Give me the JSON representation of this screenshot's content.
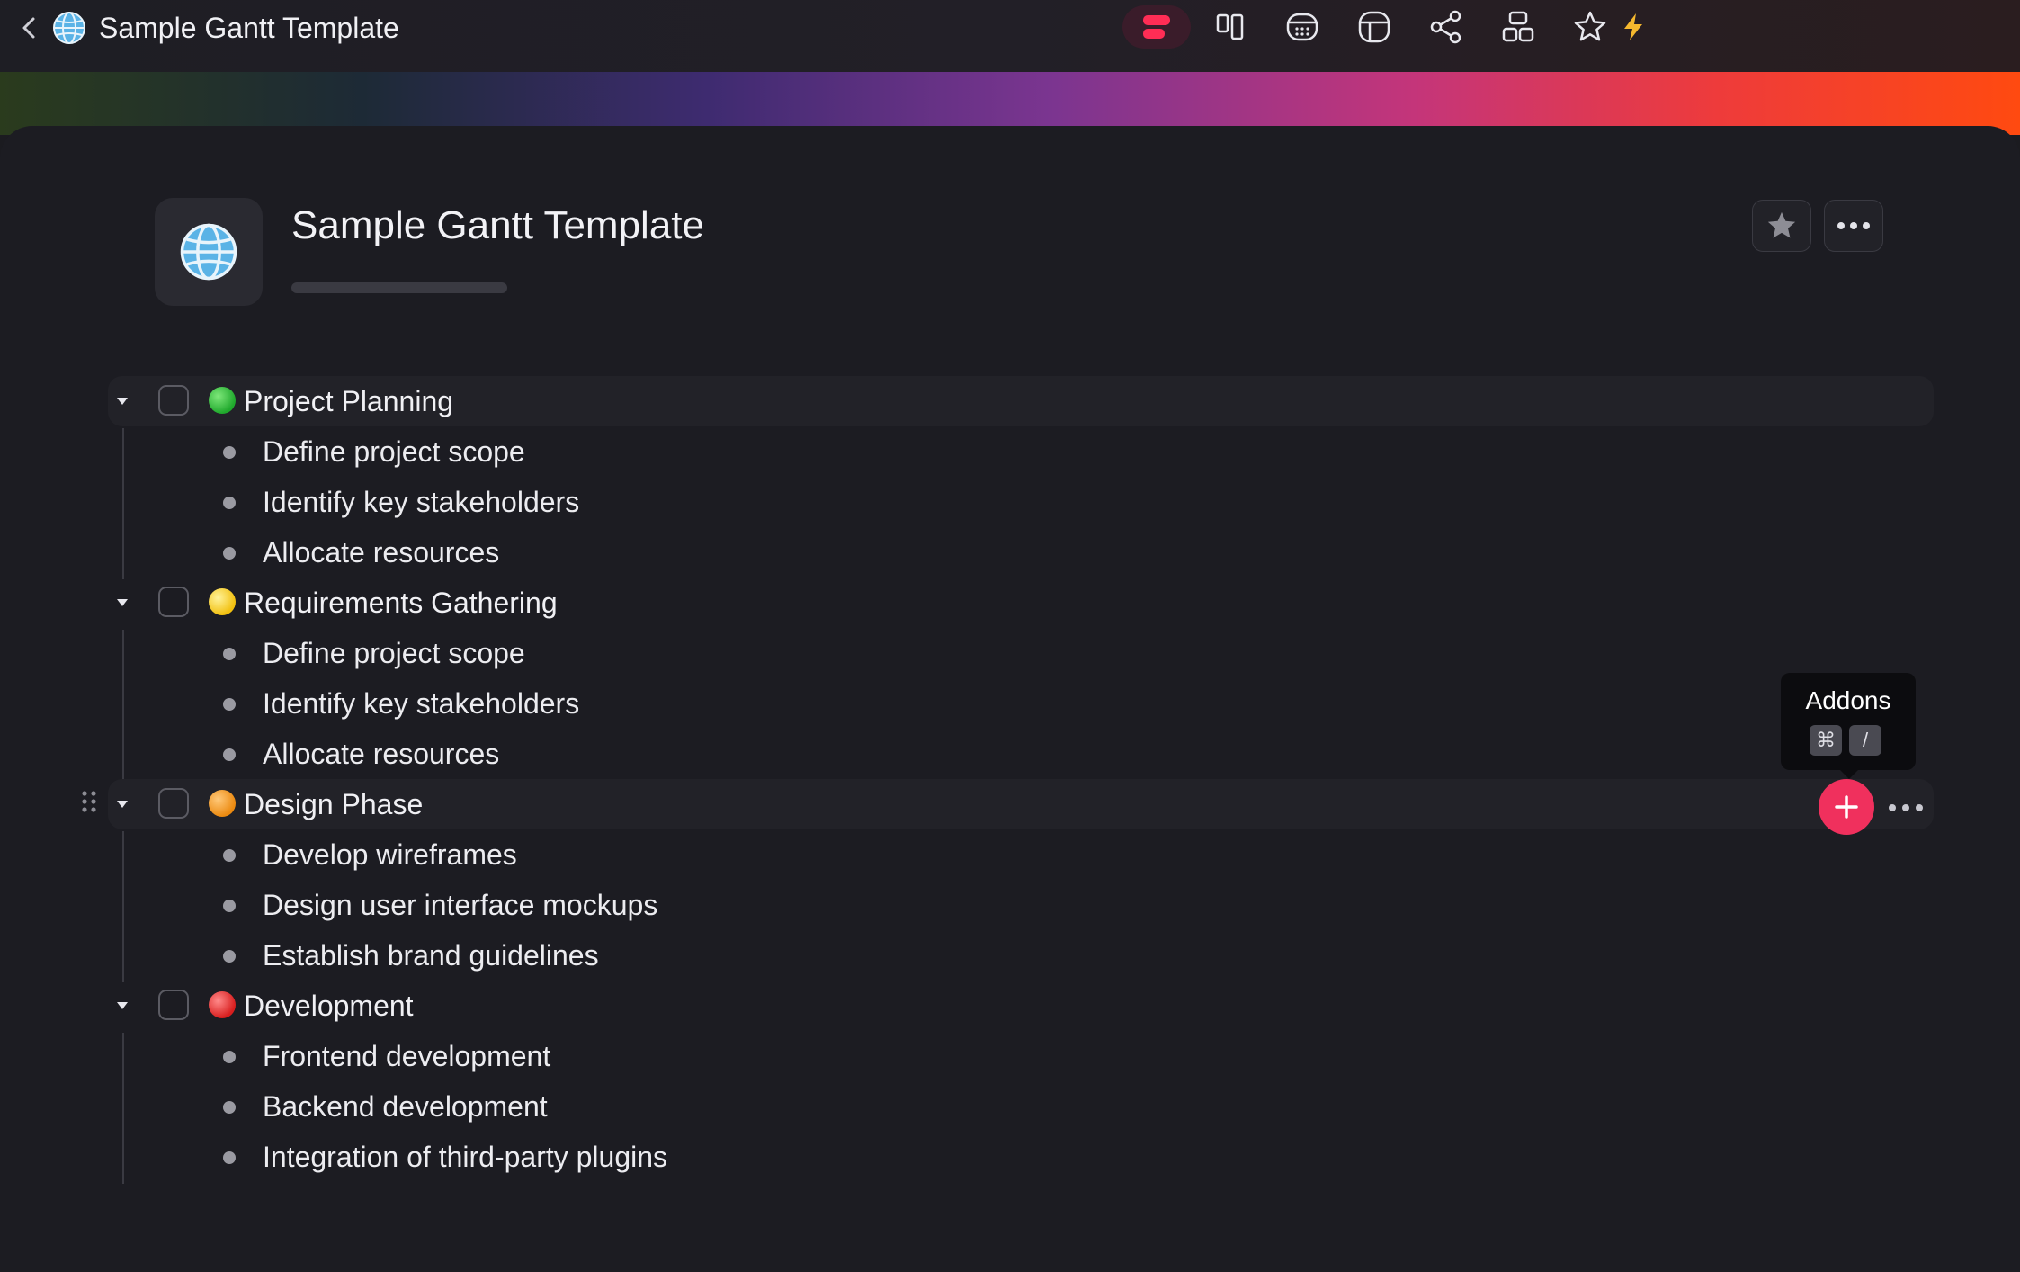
{
  "topbar": {
    "title": "Sample Gantt Template",
    "icons": [
      "chevron-left-icon",
      "globe-icon",
      "outline-view-icon",
      "board-view-icon",
      "calendar-view-icon",
      "table-view-icon",
      "share-icon",
      "templates-icon",
      "star-icon",
      "lightning-icon"
    ]
  },
  "header": {
    "title": "Sample Gantt Template",
    "icon": "globe-icon",
    "actions": [
      "favorite-star-icon",
      "more-icon"
    ]
  },
  "outline": [
    {
      "label": "Project Planning",
      "status_color": "#2fbf3a",
      "children": [
        "Define project scope",
        "Identify key stakeholders",
        "Allocate resources"
      ]
    },
    {
      "label": "Requirements Gathering",
      "status_color": "#f6c619",
      "children": [
        "Define project scope",
        "Identify key stakeholders",
        "Allocate resources"
      ]
    },
    {
      "label": "Design Phase",
      "status_color": "#f39a1c",
      "children": [
        "Develop wireframes",
        "Design user interface mockups",
        "Establish brand guidelines"
      ]
    },
    {
      "label": "Development",
      "status_color": "#e53030",
      "children": [
        "Frontend development",
        "Backend development",
        "Integration of third-party plugins"
      ]
    }
  ],
  "tooltip": {
    "label": "Addons",
    "keys": [
      "⌘",
      "/"
    ]
  },
  "colors": {
    "accent": "#f0305d",
    "active_tab": "#ff2d55",
    "lightning": "#f5b82e"
  }
}
